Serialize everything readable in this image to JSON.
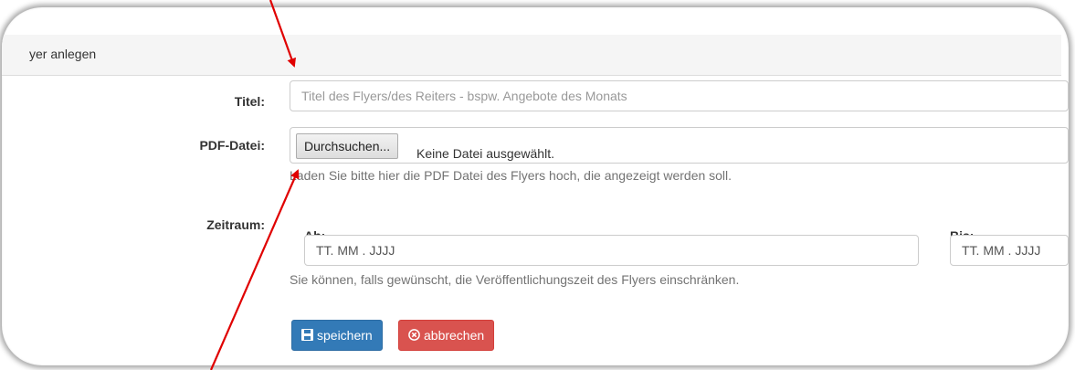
{
  "panel": {
    "title": "yer anlegen"
  },
  "form": {
    "title_label": "Titel:",
    "title_placeholder": "Titel des Flyers/des Reiters - bspw. Angebote des Monats",
    "pdf_label": "PDF-Datei:",
    "file_button": "Durchsuchen...",
    "file_status": "Keine Datei ausgewählt.",
    "pdf_help": "Laden Sie bitte hier die PDF Datei des Flyers hoch, die angezeigt werden soll.",
    "period_label": "Zeitraum:",
    "from_label": "Ab:",
    "from_placeholder": "TT. MM . JJJJ",
    "to_label": "Bis:",
    "to_placeholder": "TT. MM . JJJJ",
    "period_help": "Sie können, falls gewünscht, die Veröffentlichungszeit des Flyers einschränken."
  },
  "buttons": {
    "save": "speichern",
    "cancel": "abbrechen"
  },
  "icons": {
    "save": "floppy-disk-icon",
    "cancel": "circle-x-icon"
  },
  "colors": {
    "primary": "#337ab7",
    "danger": "#d9534f",
    "annotation_arrow": "#e00000"
  }
}
